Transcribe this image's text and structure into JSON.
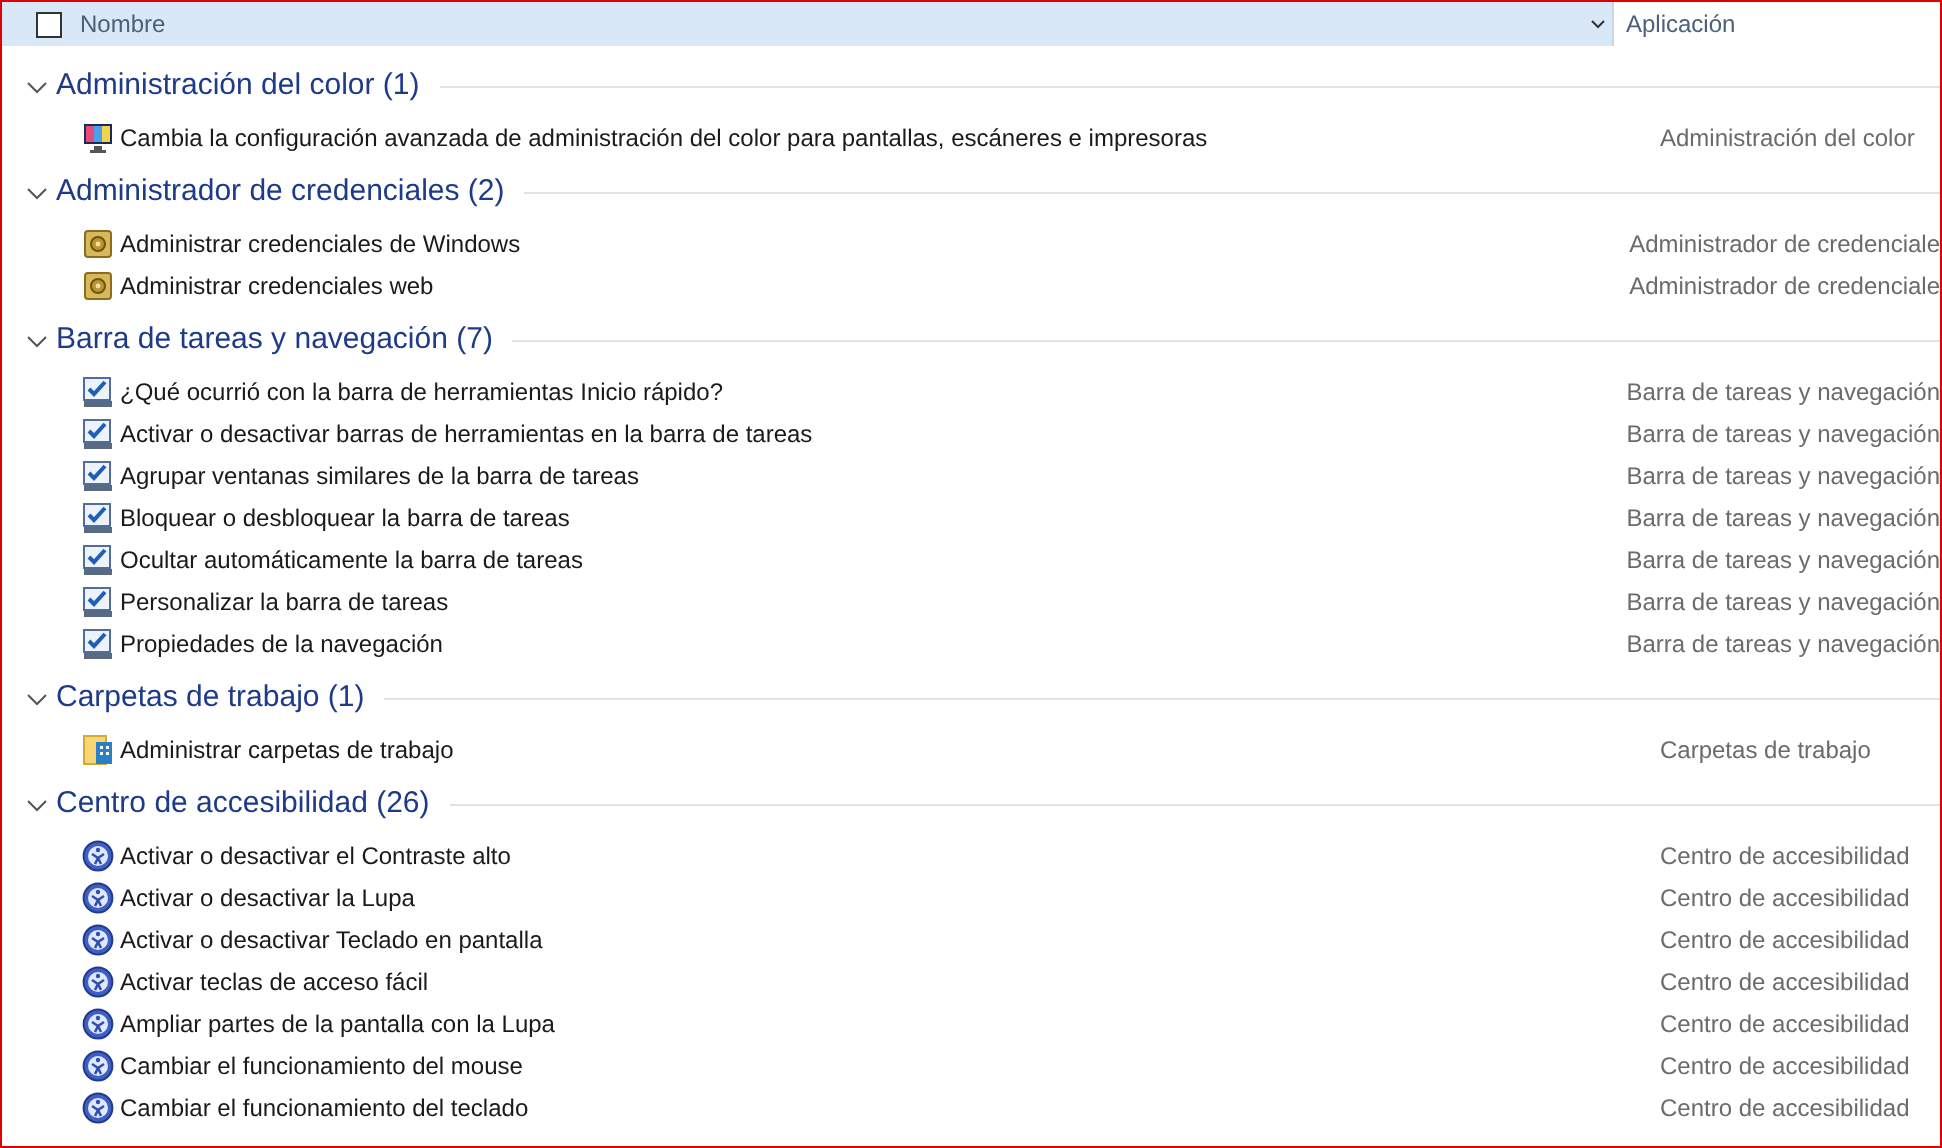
{
  "header": {
    "checked": false,
    "columns": [
      "Nombre",
      "Aplicación"
    ]
  },
  "groups": [
    {
      "title": "Administración del color (1)",
      "expanded": true,
      "items": [
        {
          "name": "Cambia la configuración avanzada de administración del color para pantallas, escáneres e impresoras",
          "app": "Administración del color",
          "kind": "monitor"
        }
      ]
    },
    {
      "title": "Administrador de credenciales (2)",
      "expanded": true,
      "items": [
        {
          "name": "Administrar credenciales de Windows",
          "app": "Administrador de credenciale",
          "kind": "vault"
        },
        {
          "name": "Administrar credenciales web",
          "app": "Administrador de credenciale",
          "kind": "vault"
        }
      ]
    },
    {
      "title": "Barra de tareas y navegación (7)",
      "expanded": true,
      "items": [
        {
          "name": "¿Qué ocurrió con la barra de herramientas Inicio rápido?",
          "app": "Barra de tareas y navegación",
          "kind": "taskbar"
        },
        {
          "name": "Activar o desactivar barras de herramientas en la barra de tareas",
          "app": "Barra de tareas y navegación",
          "kind": "taskbar"
        },
        {
          "name": "Agrupar ventanas similares de la barra de tareas",
          "app": "Barra de tareas y navegación",
          "kind": "taskbar"
        },
        {
          "name": "Bloquear o desbloquear la barra de tareas",
          "app": "Barra de tareas y navegación",
          "kind": "taskbar"
        },
        {
          "name": "Ocultar automáticamente la barra de tareas",
          "app": "Barra de tareas y navegación",
          "kind": "taskbar"
        },
        {
          "name": "Personalizar la barra de tareas",
          "app": "Barra de tareas y navegación",
          "kind": "taskbar"
        },
        {
          "name": "Propiedades de la navegación",
          "app": "Barra de tareas y navegación",
          "kind": "taskbar"
        }
      ]
    },
    {
      "title": "Carpetas de trabajo (1)",
      "expanded": true,
      "items": [
        {
          "name": "Administrar carpetas de trabajo",
          "app": "Carpetas de trabajo",
          "kind": "folder"
        }
      ]
    },
    {
      "title": "Centro de accesibilidad (26)",
      "expanded": true,
      "items": [
        {
          "name": "Activar o desactivar el Contraste alto",
          "app": "Centro de accesibilidad",
          "kind": "access"
        },
        {
          "name": "Activar o desactivar la Lupa",
          "app": "Centro de accesibilidad",
          "kind": "access"
        },
        {
          "name": "Activar o desactivar Teclado en pantalla",
          "app": "Centro de accesibilidad",
          "kind": "access"
        },
        {
          "name": "Activar teclas de acceso fácil",
          "app": "Centro de accesibilidad",
          "kind": "access"
        },
        {
          "name": "Ampliar partes de la pantalla con la Lupa",
          "app": "Centro de accesibilidad",
          "kind": "access"
        },
        {
          "name": "Cambiar el funcionamiento del mouse",
          "app": "Centro de accesibilidad",
          "kind": "access"
        },
        {
          "name": "Cambiar el funcionamiento del teclado",
          "app": "Centro de accesibilidad",
          "kind": "access"
        }
      ]
    }
  ]
}
